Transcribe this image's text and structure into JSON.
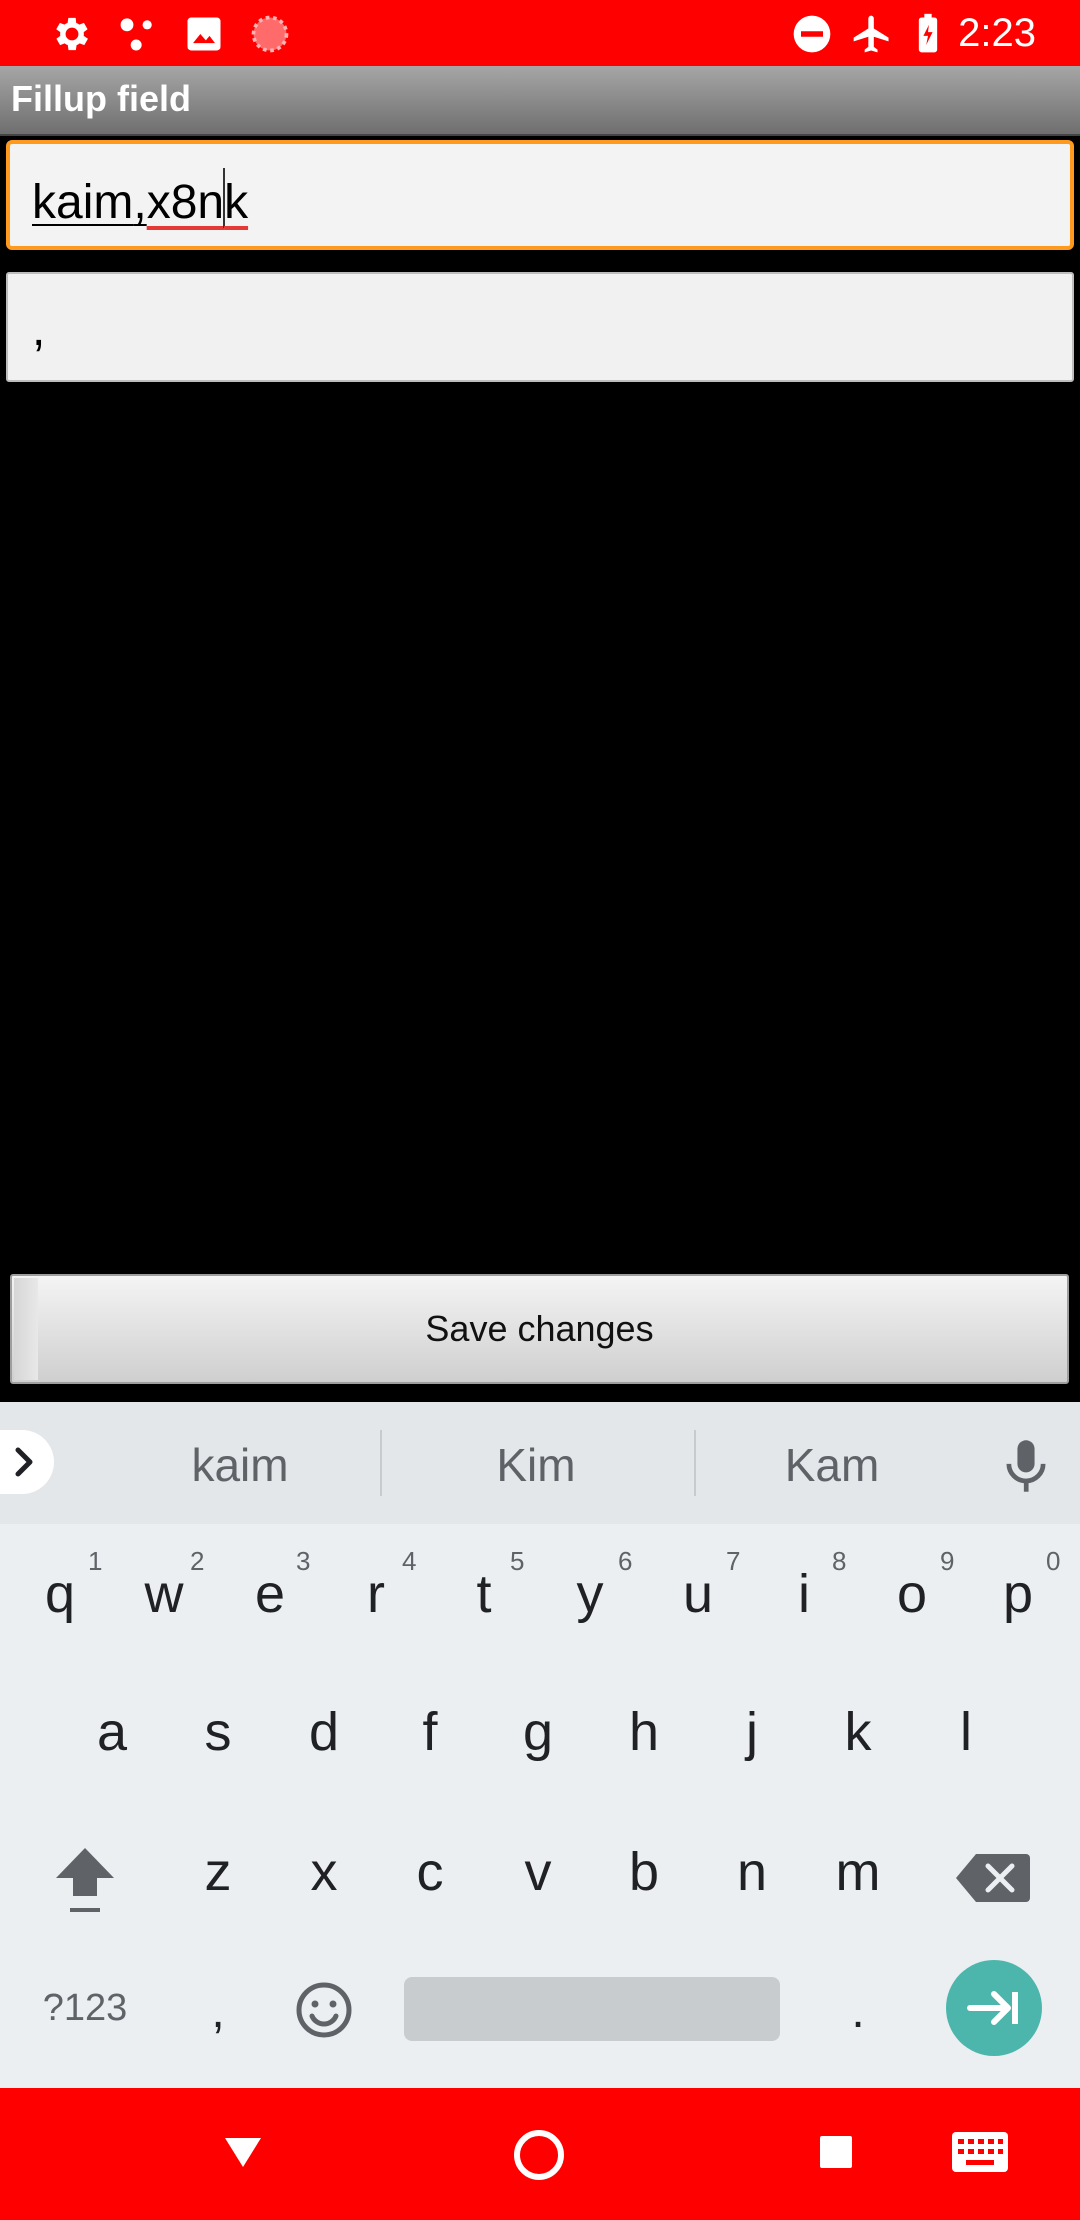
{
  "status_bar": {
    "time": "2:23",
    "left_icons": [
      "settings-icon",
      "nodes-icon",
      "image-icon",
      "loading-icon"
    ],
    "right_icons": [
      "dnd-icon",
      "airplane-icon",
      "battery-charging-icon"
    ],
    "color": "#ff0000"
  },
  "app": {
    "title": "Fillup field"
  },
  "fields": {
    "field1": {
      "part1": "kaim",
      "comma": ",",
      "part2": "x8n",
      "part3": "k"
    },
    "field2": {
      "value": ","
    }
  },
  "buttons": {
    "save_label": "Save changes"
  },
  "keyboard": {
    "suggestions": [
      "kaim",
      "Kim",
      "Kam"
    ],
    "row1": [
      "q",
      "w",
      "e",
      "r",
      "t",
      "y",
      "u",
      "i",
      "o",
      "p"
    ],
    "row1_hints": [
      "1",
      "2",
      "3",
      "4",
      "5",
      "6",
      "7",
      "8",
      "9",
      "0"
    ],
    "row2": [
      "a",
      "s",
      "d",
      "f",
      "g",
      "h",
      "j",
      "k",
      "l"
    ],
    "row3": [
      "z",
      "x",
      "c",
      "v",
      "b",
      "n",
      "m"
    ],
    "symbols_label": "?123",
    "comma_label": ",",
    "period_label": "."
  },
  "nav_bar": {
    "icons": [
      "back-icon",
      "home-icon",
      "recents-icon",
      "keyboard-icon"
    ],
    "color": "#ff0000"
  }
}
